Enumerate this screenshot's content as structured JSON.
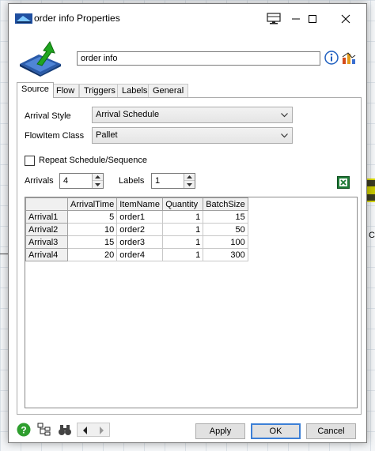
{
  "window": {
    "title": "order info  Properties",
    "name_value": "order info"
  },
  "tabs": [
    "Source",
    "Flow",
    "Triggers",
    "Labels",
    "General"
  ],
  "source": {
    "arrival_style_label": "Arrival Style",
    "arrival_style_value": "Arrival Schedule",
    "flowitem_class_label": "FlowItem Class",
    "flowitem_class_value": "Pallet",
    "repeat_label": "Repeat Schedule/Sequence",
    "repeat_checked": false,
    "arrivals_label": "Arrivals",
    "arrivals_value": "4",
    "labels_label": "Labels",
    "labels_value": "1"
  },
  "table": {
    "columns": [
      "",
      "ArrivalTime",
      "ItemName",
      "Quantity",
      "BatchSize"
    ],
    "rows": [
      [
        "Arrival1",
        "5",
        "order1",
        "1",
        "15"
      ],
      [
        "Arrival2",
        "10",
        "order2",
        "1",
        "50"
      ],
      [
        "Arrival3",
        "15",
        "order3",
        "1",
        "100"
      ],
      [
        "Arrival4",
        "20",
        "order4",
        "1",
        "300"
      ]
    ]
  },
  "buttons": {
    "apply": "Apply",
    "ok": "OK",
    "cancel": "Cancel"
  },
  "background": {
    "object_label": "C"
  },
  "colors": {
    "accent": "#3c7fd6",
    "help_green": "#2e9e2e",
    "excel_green": "#1d7a35"
  }
}
